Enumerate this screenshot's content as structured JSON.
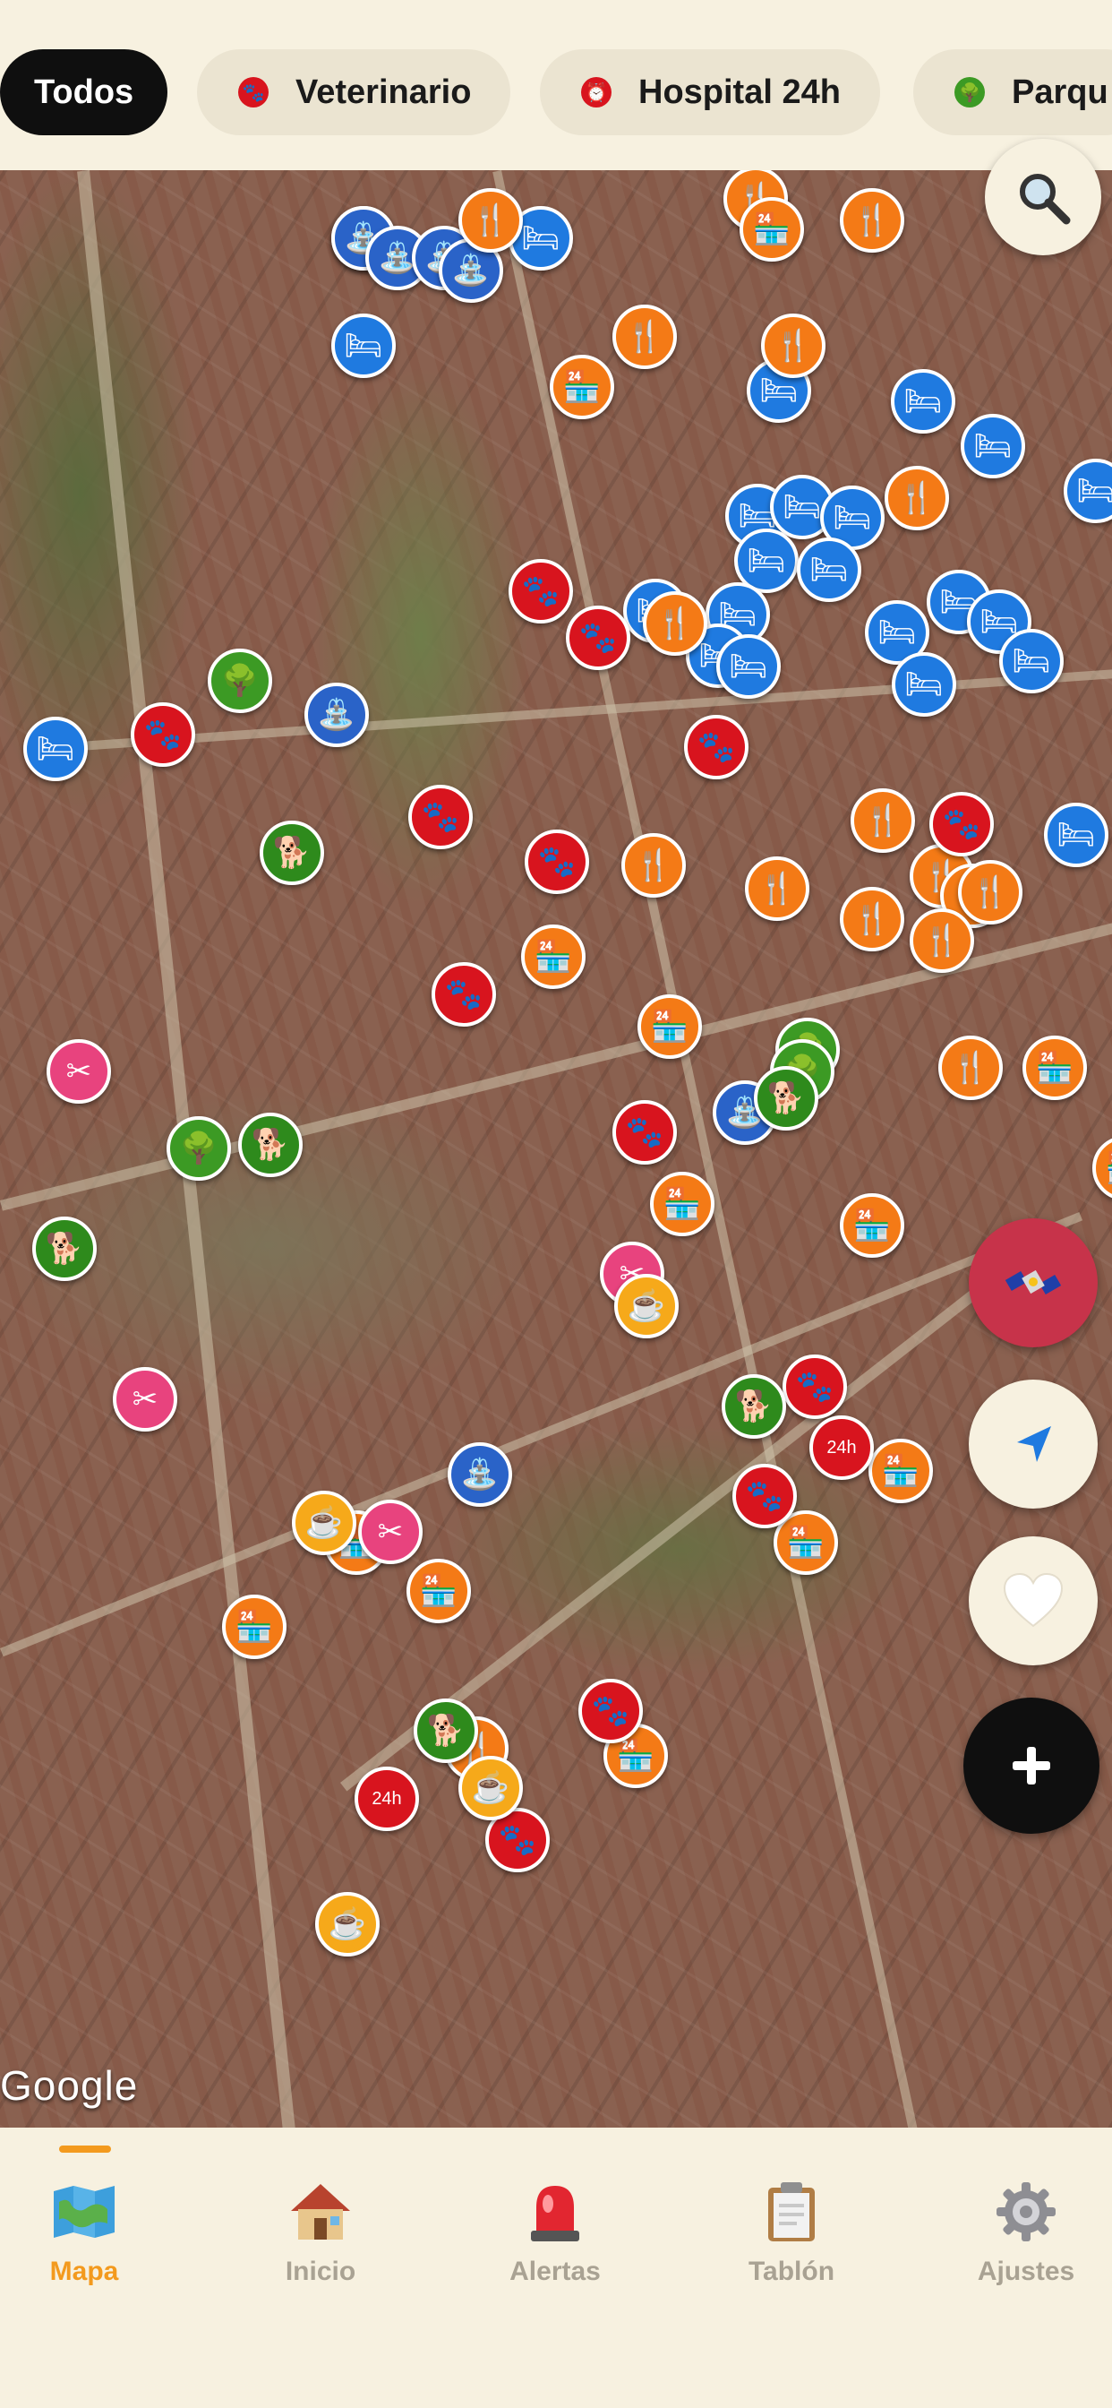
{
  "filters": [
    {
      "label": "Todos",
      "active": true
    },
    {
      "label": "Veterinario",
      "active": false,
      "icon": "paw-icon",
      "color": "#d8141e"
    },
    {
      "label": "Hospital 24h",
      "active": false,
      "icon": "alarm-clock-icon",
      "color": "#d8141e"
    },
    {
      "label": "Parqu",
      "active": false,
      "icon": "park-icon",
      "color": "#3c9a24"
    }
  ],
  "map": {
    "attribution": "Google",
    "marker_types": {
      "vet": {
        "icon": "paw-icon",
        "color": "#d8141e"
      },
      "hospital24h": {
        "icon": "alarm-clock-24h-icon",
        "color": "#d8141e",
        "label": "24h"
      },
      "restaurant": {
        "icon": "fork-knife-icon",
        "color": "#f47a16"
      },
      "shop": {
        "icon": "shop-icon",
        "color": "#f47a16"
      },
      "hotel": {
        "icon": "bed-paw-icon",
        "color": "#1f7ae0"
      },
      "park": {
        "icon": "park-bench-icon",
        "color": "#3c9a24"
      },
      "dog_area": {
        "icon": "dog-icon",
        "color": "#2e8a1c"
      },
      "fountain": {
        "icon": "fountain-icon",
        "color": "#2a63c8"
      },
      "grooming": {
        "icon": "scissors-icon",
        "color": "#e8437e"
      },
      "cafe": {
        "icon": "coffee-cup-icon",
        "color": "#f6a91a"
      }
    }
  },
  "controls": {
    "search_icon": "search-icon",
    "layer_icon": "satellite-icon",
    "locate_icon": "location-arrow-icon",
    "favorites_icon": "heart-icon",
    "add_icon": "plus-icon"
  },
  "tabs": [
    {
      "label": "Mapa",
      "icon": "map-icon",
      "active": true
    },
    {
      "label": "Inicio",
      "icon": "house-icon",
      "active": false
    },
    {
      "label": "Alertas",
      "icon": "siren-icon",
      "active": false
    },
    {
      "label": "Tablón",
      "icon": "clipboard-icon",
      "active": false
    },
    {
      "label": "Ajustes",
      "icon": "gear-icon",
      "active": false
    }
  ],
  "colors": {
    "accent": "#f39a1e",
    "background": "#f7f1e0",
    "chip_active": "#0f0f0f",
    "chip_inactive": "#ebe4d1"
  }
}
